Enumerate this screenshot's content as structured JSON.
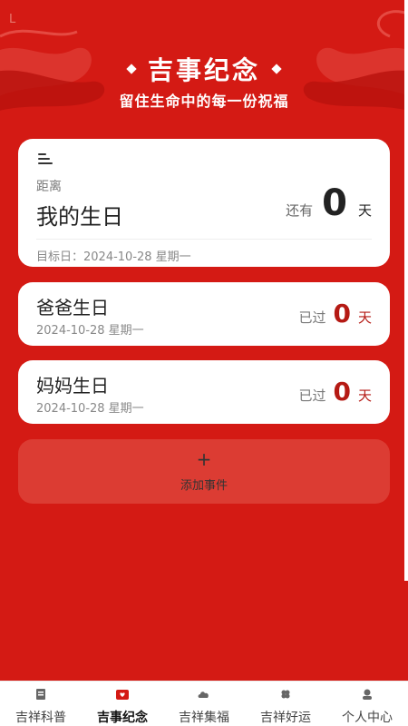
{
  "status": {
    "mark": "L"
  },
  "header": {
    "title": "吉事纪念",
    "subtitle": "留住生命中的每一份祝福"
  },
  "main_card": {
    "distance_label": "距离",
    "name": "我的生日",
    "remain_prefix": "还有",
    "days": "0",
    "unit": "天",
    "target_date": "目标日：2024-10-28 星期一"
  },
  "events": [
    {
      "name": "爸爸生日",
      "date": "2024-10-28 星期一",
      "prefix": "已过",
      "days": "0",
      "unit": "天"
    },
    {
      "name": "妈妈生日",
      "date": "2024-10-28 星期一",
      "prefix": "已过",
      "days": "0",
      "unit": "天"
    }
  ],
  "add_event": {
    "plus": "+",
    "label": "添加事件"
  },
  "tabbar": {
    "items": [
      {
        "label": "吉祥科普",
        "icon": "book-icon"
      },
      {
        "label": "吉事纪念",
        "icon": "mail-heart-icon",
        "active": true
      },
      {
        "label": "吉祥集福",
        "icon": "cloud-icon"
      },
      {
        "label": "吉祥好运",
        "icon": "clover-icon"
      },
      {
        "label": "个人中心",
        "icon": "user-icon"
      }
    ]
  },
  "colors": {
    "background": "#d41a14",
    "accent": "#b51a14",
    "card": "#ffffff",
    "add_box": "#dc3c33"
  }
}
